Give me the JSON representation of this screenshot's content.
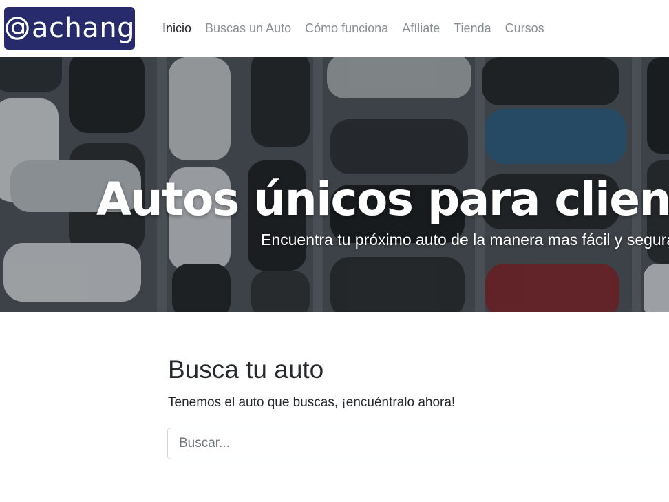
{
  "header": {
    "logo_text": "achang",
    "nav": [
      {
        "label": "Inicio",
        "active": true
      },
      {
        "label": "Buscas un Auto"
      },
      {
        "label": "Cómo funciona"
      },
      {
        "label": "Afíliate"
      },
      {
        "label": "Tienda"
      },
      {
        "label": "Cursos"
      }
    ]
  },
  "hero": {
    "title": "Autos únicos para clientes únicos",
    "subtitle": "Encuentra tu próximo auto de la manera mas fácil y segura"
  },
  "search": {
    "title": "Busca tu auto",
    "description": "Tenemos el auto que buscas, ¡encuéntralo ahora!",
    "placeholder": "Buscar..."
  },
  "colors": {
    "logo_bg": "#272a6b",
    "nav_active": "#1f2227",
    "nav_inactive": "#8a8f94",
    "hero_overlay": "#3f464c"
  }
}
